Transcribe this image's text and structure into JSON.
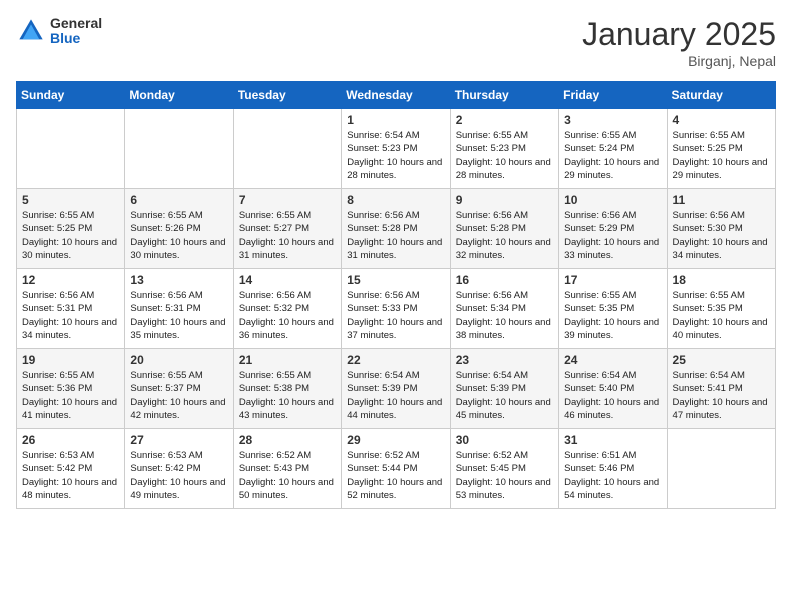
{
  "header": {
    "logo_general": "General",
    "logo_blue": "Blue",
    "month_title": "January 2025",
    "location": "Birganj, Nepal"
  },
  "days_of_week": [
    "Sunday",
    "Monday",
    "Tuesday",
    "Wednesday",
    "Thursday",
    "Friday",
    "Saturday"
  ],
  "weeks": [
    {
      "days": [
        {
          "num": "",
          "info": ""
        },
        {
          "num": "",
          "info": ""
        },
        {
          "num": "",
          "info": ""
        },
        {
          "num": "1",
          "info": "Sunrise: 6:54 AM\nSunset: 5:23 PM\nDaylight: 10 hours\nand 28 minutes."
        },
        {
          "num": "2",
          "info": "Sunrise: 6:55 AM\nSunset: 5:23 PM\nDaylight: 10 hours\nand 28 minutes."
        },
        {
          "num": "3",
          "info": "Sunrise: 6:55 AM\nSunset: 5:24 PM\nDaylight: 10 hours\nand 29 minutes."
        },
        {
          "num": "4",
          "info": "Sunrise: 6:55 AM\nSunset: 5:25 PM\nDaylight: 10 hours\nand 29 minutes."
        }
      ]
    },
    {
      "days": [
        {
          "num": "5",
          "info": "Sunrise: 6:55 AM\nSunset: 5:25 PM\nDaylight: 10 hours\nand 30 minutes."
        },
        {
          "num": "6",
          "info": "Sunrise: 6:55 AM\nSunset: 5:26 PM\nDaylight: 10 hours\nand 30 minutes."
        },
        {
          "num": "7",
          "info": "Sunrise: 6:55 AM\nSunset: 5:27 PM\nDaylight: 10 hours\nand 31 minutes."
        },
        {
          "num": "8",
          "info": "Sunrise: 6:56 AM\nSunset: 5:28 PM\nDaylight: 10 hours\nand 31 minutes."
        },
        {
          "num": "9",
          "info": "Sunrise: 6:56 AM\nSunset: 5:28 PM\nDaylight: 10 hours\nand 32 minutes."
        },
        {
          "num": "10",
          "info": "Sunrise: 6:56 AM\nSunset: 5:29 PM\nDaylight: 10 hours\nand 33 minutes."
        },
        {
          "num": "11",
          "info": "Sunrise: 6:56 AM\nSunset: 5:30 PM\nDaylight: 10 hours\nand 34 minutes."
        }
      ]
    },
    {
      "days": [
        {
          "num": "12",
          "info": "Sunrise: 6:56 AM\nSunset: 5:31 PM\nDaylight: 10 hours\nand 34 minutes."
        },
        {
          "num": "13",
          "info": "Sunrise: 6:56 AM\nSunset: 5:31 PM\nDaylight: 10 hours\nand 35 minutes."
        },
        {
          "num": "14",
          "info": "Sunrise: 6:56 AM\nSunset: 5:32 PM\nDaylight: 10 hours\nand 36 minutes."
        },
        {
          "num": "15",
          "info": "Sunrise: 6:56 AM\nSunset: 5:33 PM\nDaylight: 10 hours\nand 37 minutes."
        },
        {
          "num": "16",
          "info": "Sunrise: 6:56 AM\nSunset: 5:34 PM\nDaylight: 10 hours\nand 38 minutes."
        },
        {
          "num": "17",
          "info": "Sunrise: 6:55 AM\nSunset: 5:35 PM\nDaylight: 10 hours\nand 39 minutes."
        },
        {
          "num": "18",
          "info": "Sunrise: 6:55 AM\nSunset: 5:35 PM\nDaylight: 10 hours\nand 40 minutes."
        }
      ]
    },
    {
      "days": [
        {
          "num": "19",
          "info": "Sunrise: 6:55 AM\nSunset: 5:36 PM\nDaylight: 10 hours\nand 41 minutes."
        },
        {
          "num": "20",
          "info": "Sunrise: 6:55 AM\nSunset: 5:37 PM\nDaylight: 10 hours\nand 42 minutes."
        },
        {
          "num": "21",
          "info": "Sunrise: 6:55 AM\nSunset: 5:38 PM\nDaylight: 10 hours\nand 43 minutes."
        },
        {
          "num": "22",
          "info": "Sunrise: 6:54 AM\nSunset: 5:39 PM\nDaylight: 10 hours\nand 44 minutes."
        },
        {
          "num": "23",
          "info": "Sunrise: 6:54 AM\nSunset: 5:39 PM\nDaylight: 10 hours\nand 45 minutes."
        },
        {
          "num": "24",
          "info": "Sunrise: 6:54 AM\nSunset: 5:40 PM\nDaylight: 10 hours\nand 46 minutes."
        },
        {
          "num": "25",
          "info": "Sunrise: 6:54 AM\nSunset: 5:41 PM\nDaylight: 10 hours\nand 47 minutes."
        }
      ]
    },
    {
      "days": [
        {
          "num": "26",
          "info": "Sunrise: 6:53 AM\nSunset: 5:42 PM\nDaylight: 10 hours\nand 48 minutes."
        },
        {
          "num": "27",
          "info": "Sunrise: 6:53 AM\nSunset: 5:42 PM\nDaylight: 10 hours\nand 49 minutes."
        },
        {
          "num": "28",
          "info": "Sunrise: 6:52 AM\nSunset: 5:43 PM\nDaylight: 10 hours\nand 50 minutes."
        },
        {
          "num": "29",
          "info": "Sunrise: 6:52 AM\nSunset: 5:44 PM\nDaylight: 10 hours\nand 52 minutes."
        },
        {
          "num": "30",
          "info": "Sunrise: 6:52 AM\nSunset: 5:45 PM\nDaylight: 10 hours\nand 53 minutes."
        },
        {
          "num": "31",
          "info": "Sunrise: 6:51 AM\nSunset: 5:46 PM\nDaylight: 10 hours\nand 54 minutes."
        },
        {
          "num": "",
          "info": ""
        }
      ]
    }
  ]
}
